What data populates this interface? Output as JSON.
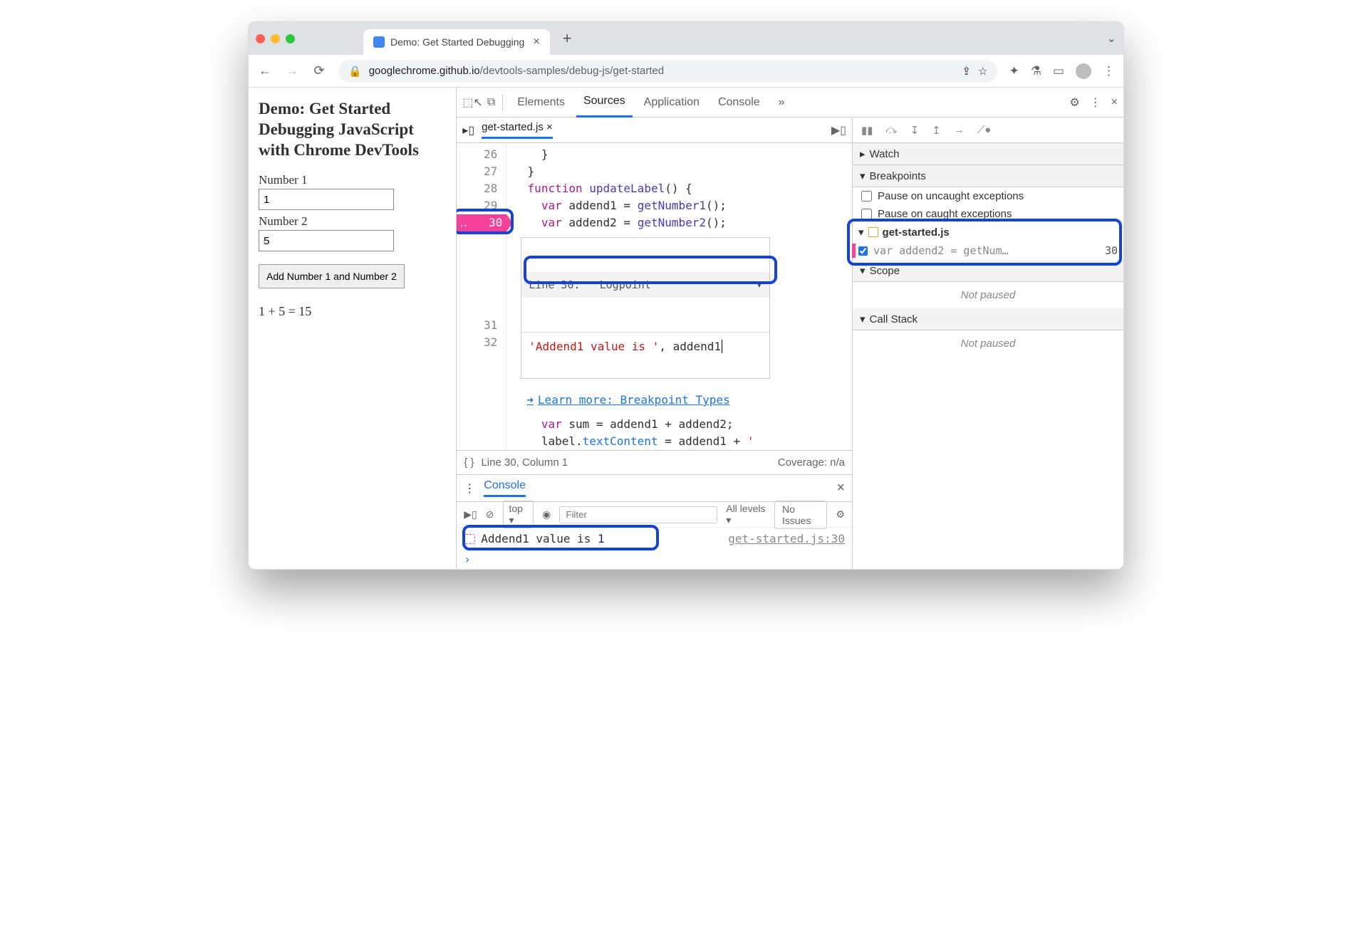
{
  "tab": {
    "title": "Demo: Get Started Debugging"
  },
  "url": {
    "host": "googlechrome.github.io",
    "path": "/devtools-samples/debug-js/get-started"
  },
  "page": {
    "heading": "Demo: Get Started Debugging JavaScript with Chrome DevTools",
    "label1": "Number 1",
    "val1": "1",
    "label2": "Number 2",
    "val2": "5",
    "button": "Add Number 1 and Number 2",
    "result": "1 + 5 = 15"
  },
  "devtools": {
    "tabs": {
      "elements": "Elements",
      "sources": "Sources",
      "application": "Application",
      "console": "Console",
      "more": "»"
    },
    "file": "get-started.js",
    "gutter": [
      "26",
      "27",
      "28",
      "29",
      "30",
      "",
      "",
      "",
      "",
      "",
      "31",
      "32"
    ],
    "code": {
      "l26": "    }",
      "l27": "  }",
      "l28_a": "  ",
      "l28_kw": "function",
      "l28_b": " ",
      "l28_fn": "updateLabel",
      "l28_c": "() {",
      "l29_a": "    ",
      "l29_kw": "var",
      "l29_b": " addend1 = ",
      "l29_fn": "getNumber1",
      "l29_c": "();",
      "l30_a": "    ",
      "l30_kw": "var",
      "l30_b": " addend2 = ",
      "l30_fn": "getNumber2",
      "l30_c": "();",
      "l31_a": "    ",
      "l31_kw": "var",
      "l31_b": " sum = addend1 + addend2;",
      "l32_a": "    label.",
      "l32_fn": "textContent",
      "l32_b": " = addend1 + ",
      "l32_str": "' "
    },
    "logpoint": {
      "header": "Line 30:   Logpoint",
      "value_str": "'Addend1 value is '",
      "value_rest": ", addend1"
    },
    "learn": "Learn more: Breakpoint Types",
    "status": {
      "pos": "Line 30, Column 1",
      "coverage": "Coverage: n/a",
      "braces": "{ }"
    },
    "debugger": {
      "watch": "Watch",
      "breakpoints": "Breakpoints",
      "pauseUncaught": "Pause on uncaught exceptions",
      "pauseCaught": "Pause on caught exceptions",
      "bpfile": "get-started.js",
      "bpline": "var addend2 = getNum…",
      "bplinenum": "30",
      "scope": "Scope",
      "notpaused": "Not paused",
      "callstack": "Call Stack",
      "notpaused2": "Not paused"
    }
  },
  "console": {
    "tab": "Console",
    "top": "top ▾",
    "filter_ph": "Filter",
    "levels": "All levels ▾",
    "noissues": "No Issues",
    "log_text": "Addend1 value is ",
    "log_val": " 1",
    "log_src": "get-started.js:30"
  }
}
